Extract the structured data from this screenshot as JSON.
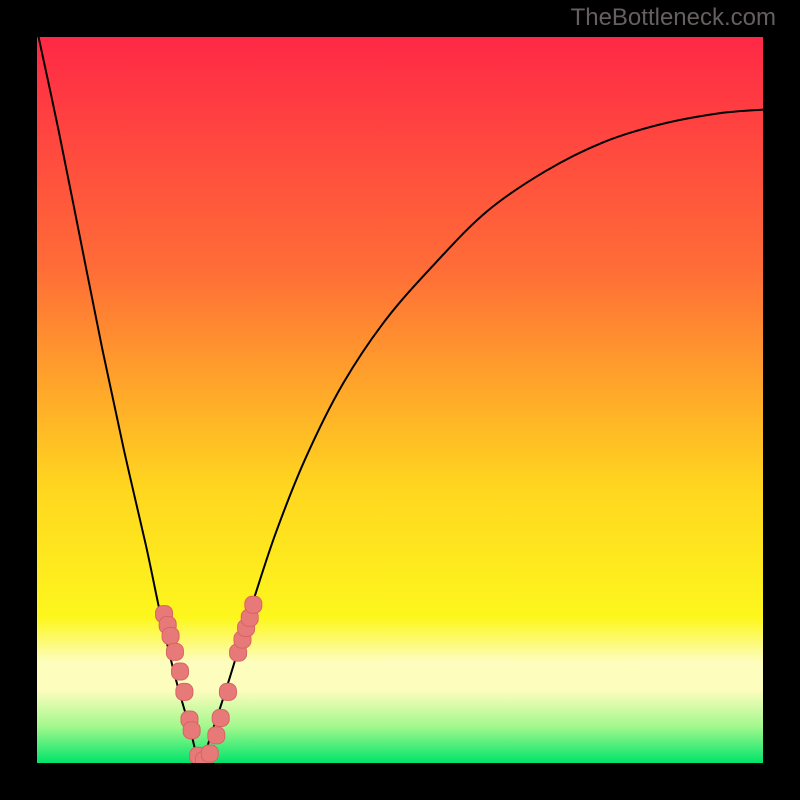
{
  "watermark": "TheBottleneck.com",
  "colors": {
    "page_bg": "#000000",
    "gradient_top": "#ff2846",
    "gradient_upper_mid": "#ff6d37",
    "gradient_mid": "#ffd61f",
    "gradient_low_yellow": "#fdf71d",
    "gradient_pale_band": "#fdfdbd",
    "gradient_light_green": "#a2f88d",
    "gradient_bottom": "#00e46a",
    "curve": "#000000",
    "marker_fill": "#e77a79",
    "marker_stroke": "#d86363"
  },
  "chart_data": {
    "type": "line",
    "title": "",
    "xlabel": "",
    "ylabel": "",
    "xlim": [
      0,
      1
    ],
    "ylim": [
      0,
      1
    ],
    "minimum_x": 0.225,
    "series": [
      {
        "name": "bottleneck-curve",
        "x": [
          0.0,
          0.03,
          0.06,
          0.09,
          0.12,
          0.15,
          0.17,
          0.19,
          0.21,
          0.225,
          0.24,
          0.26,
          0.28,
          0.3,
          0.33,
          0.37,
          0.42,
          0.48,
          0.55,
          0.62,
          0.7,
          0.78,
          0.86,
          0.94,
          1.0
        ],
        "y": [
          1.01,
          0.87,
          0.72,
          0.57,
          0.43,
          0.3,
          0.205,
          0.12,
          0.05,
          0.0,
          0.04,
          0.1,
          0.165,
          0.23,
          0.32,
          0.42,
          0.52,
          0.61,
          0.69,
          0.76,
          0.815,
          0.855,
          0.88,
          0.895,
          0.9
        ]
      }
    ],
    "markers": [
      {
        "x": 0.175,
        "y": 0.205,
        "series": "left-flank"
      },
      {
        "x": 0.18,
        "y": 0.19,
        "series": "left-flank"
      },
      {
        "x": 0.184,
        "y": 0.175,
        "series": "left-flank"
      },
      {
        "x": 0.19,
        "y": 0.153,
        "series": "left-flank"
      },
      {
        "x": 0.197,
        "y": 0.126,
        "series": "left-flank"
      },
      {
        "x": 0.203,
        "y": 0.098,
        "series": "left-flank"
      },
      {
        "x": 0.21,
        "y": 0.06,
        "series": "left-flank"
      },
      {
        "x": 0.213,
        "y": 0.045,
        "series": "left-flank"
      },
      {
        "x": 0.222,
        "y": 0.01,
        "series": "trough"
      },
      {
        "x": 0.23,
        "y": 0.004,
        "series": "trough"
      },
      {
        "x": 0.238,
        "y": 0.013,
        "series": "trough"
      },
      {
        "x": 0.247,
        "y": 0.038,
        "series": "right-flank"
      },
      {
        "x": 0.253,
        "y": 0.062,
        "series": "right-flank"
      },
      {
        "x": 0.263,
        "y": 0.098,
        "series": "right-flank"
      },
      {
        "x": 0.277,
        "y": 0.152,
        "series": "right-flank"
      },
      {
        "x": 0.283,
        "y": 0.17,
        "series": "right-flank"
      },
      {
        "x": 0.288,
        "y": 0.186,
        "series": "right-flank"
      },
      {
        "x": 0.293,
        "y": 0.2,
        "series": "right-flank"
      },
      {
        "x": 0.298,
        "y": 0.218,
        "series": "right-flank"
      }
    ],
    "marker_shape": "rounded-rect",
    "marker_size_px": 17
  }
}
